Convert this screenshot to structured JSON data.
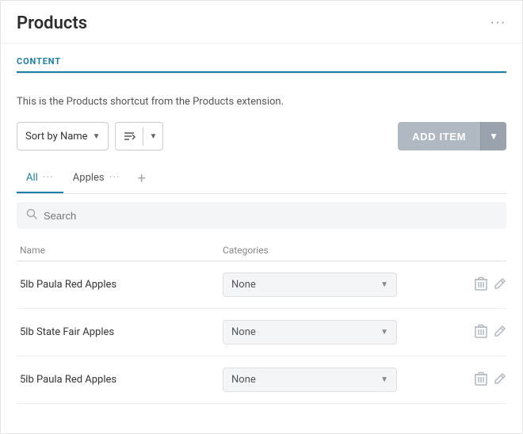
{
  "header": {
    "title": "Products",
    "menu_icon": "···"
  },
  "content_label": "CONTENT",
  "description": "This is the Products shortcut from the Products extension.",
  "toolbar": {
    "sort_label": "Sort by Name",
    "add_item_label": "ADD ITEM"
  },
  "tabs": [
    {
      "label": "All",
      "active": true
    },
    {
      "label": "Apples",
      "active": false
    }
  ],
  "search": {
    "placeholder": "Search"
  },
  "table": {
    "columns": [
      "Name",
      "Categories"
    ],
    "rows": [
      {
        "name": "5lb Paula Red Apples",
        "category": "None"
      },
      {
        "name": "5lb State Fair Apples",
        "category": "None"
      },
      {
        "name": "5lb Paula Red Apples",
        "category": "None"
      }
    ]
  }
}
